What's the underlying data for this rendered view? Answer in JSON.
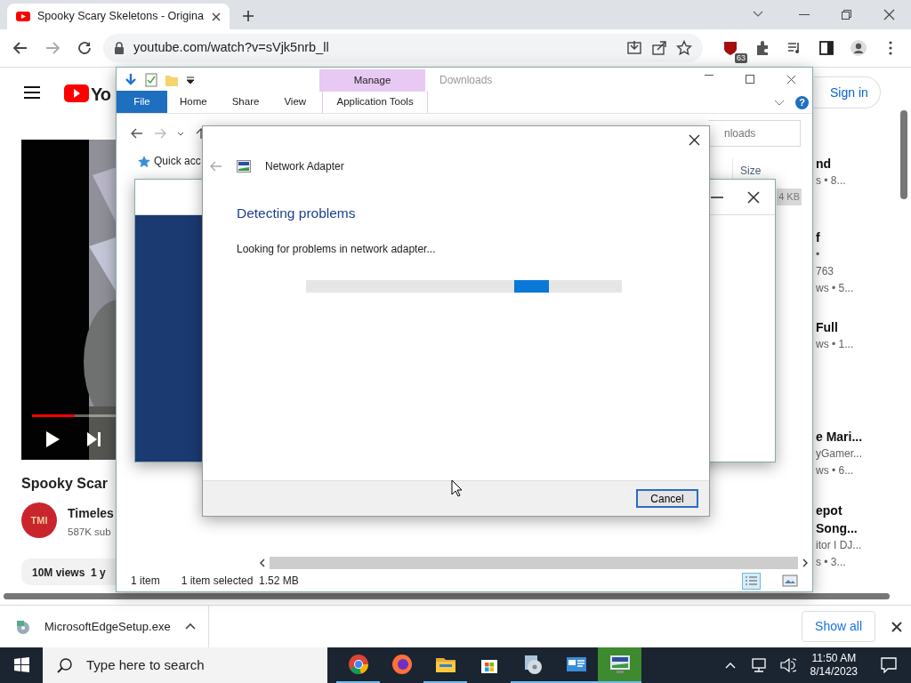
{
  "browser": {
    "tab_title": "Spooky Scary Skeletons - Origina",
    "url": "youtube.com/watch?v=sVjk5nrb_ll",
    "extension_badge": "63",
    "forward_disabled": true
  },
  "youtube": {
    "logo_text": "Yo",
    "sign_in": "Sign in",
    "video_progress": {
      "level": 0.12
    },
    "title": "Spooky Scar",
    "avatar_text": "TMI",
    "channel": "Timeles",
    "subscribers": "587K sub",
    "views": "10M views  1 y",
    "sidebar": [
      {
        "lines": [
          {
            "text": "nd",
            "kind": "title"
          },
          {
            "text": "s  • 8...",
            "kind": "meta"
          }
        ]
      },
      {
        "lines": [
          {
            "text": "f",
            "kind": "title"
          },
          {
            "text": "•",
            "kind": "meta"
          },
          {
            "text": "763",
            "kind": "meta"
          },
          {
            "text": "ws  • 5...",
            "kind": "meta"
          }
        ]
      },
      {
        "lines": [
          {
            "text": "Full",
            "kind": "title"
          },
          {
            "text": "ws  • 1...",
            "kind": "meta"
          }
        ]
      },
      {
        "lines": [
          {
            "text": "e Mari...",
            "kind": "title"
          },
          {
            "text": "yGamer...",
            "kind": "meta"
          },
          {
            "text": "ws  • 6...",
            "kind": "meta"
          }
        ]
      },
      {
        "lines": [
          {
            "text": "epot",
            "kind": "title"
          },
          {
            "text": "Song...",
            "kind": "title"
          },
          {
            "text": "itor I DJ...",
            "kind": "meta"
          },
          {
            "text": "s  • 3...",
            "kind": "meta"
          }
        ]
      }
    ]
  },
  "explorer": {
    "title": "Downloads",
    "help": "?",
    "context_header": "Manage",
    "tabs": [
      {
        "label": "File",
        "selected": true
      },
      {
        "label": "Home",
        "selected": false
      },
      {
        "label": "Share",
        "selected": false
      },
      {
        "label": "View",
        "selected": false
      },
      {
        "label": "Application Tools",
        "selected": false
      }
    ],
    "search_placeholder": "nloads",
    "column": "Size",
    "nav_item": "Quick acc",
    "row_size": "4 KB",
    "status": [
      "1 item",
      "1 item selected  1.52 MB"
    ]
  },
  "dialog": {
    "heading": "Network Adapter",
    "title": "Detecting problems",
    "message": "Looking for problems in network adapter...",
    "progress": {
      "level": 0.74
    },
    "cancel": "Cancel"
  },
  "download_bar": {
    "file": "MicrosoftEdgeSetup.exe",
    "show_all": "Show all"
  },
  "taskbar": {
    "search_placeholder": "Type here to search",
    "time": "11:50 AM",
    "date": "8/14/2023",
    "apps": [
      {
        "kind": "chrome",
        "running": true,
        "selected": false
      },
      {
        "kind": "firefox",
        "running": false,
        "selected": false
      },
      {
        "kind": "folder",
        "running": true,
        "selected": false
      },
      {
        "kind": "store",
        "running": false,
        "selected": false
      },
      {
        "kind": "setup",
        "running": true,
        "selected": false
      },
      {
        "kind": "panel",
        "running": true,
        "selected": false
      },
      {
        "kind": "troubleshooter",
        "running": true,
        "selected": true
      }
    ]
  }
}
